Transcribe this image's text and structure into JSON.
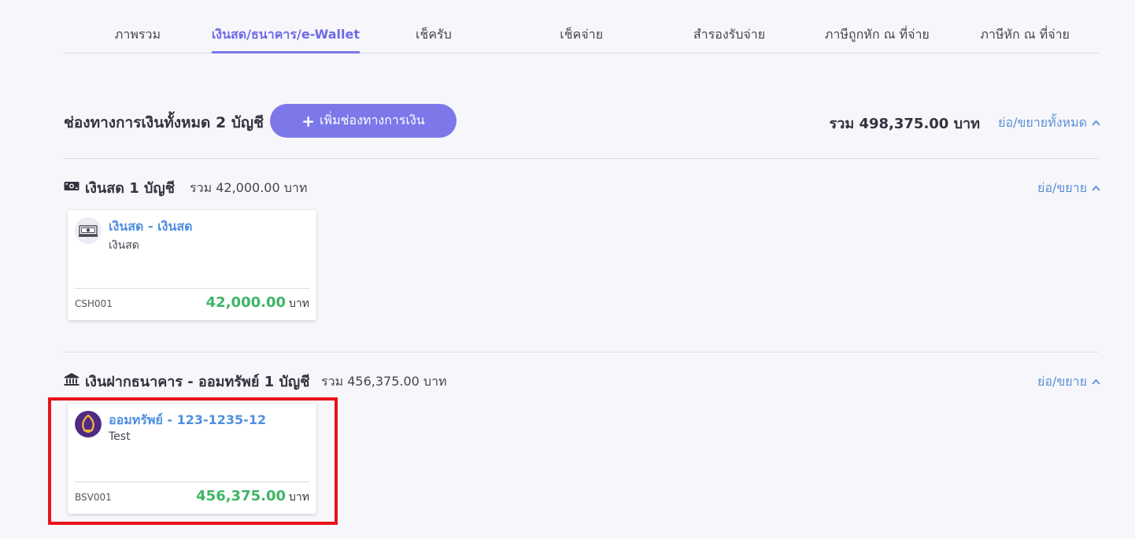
{
  "tabs": [
    {
      "label": "ภาพรวม",
      "active": false
    },
    {
      "label": "เงินสด/ธนาคาร/e-Wallet",
      "active": true
    },
    {
      "label": "เช็ครับ",
      "active": false
    },
    {
      "label": "เช็คจ่าย",
      "active": false
    },
    {
      "label": "สำรองรับจ่าย",
      "active": false
    },
    {
      "label": "ภาษีถูกหัก ณ ที่จ่าย",
      "active": false
    },
    {
      "label": "ภาษีหัก ณ ที่จ่าย",
      "active": false
    }
  ],
  "header": {
    "title": "ช่องทางการเงินทั้งหมด 2 บัญชี",
    "add_button_label": "เพิ่มช่องทางการเงิน",
    "total": "รวม 498,375.00 บาท",
    "collapse_all_label": "ย่อ/ขยายทั้งหมด"
  },
  "sections": [
    {
      "icon": "cash-icon",
      "title": "เงินสด 1 บัญชี",
      "total": "รวม 42,000.00 บาท",
      "collapse_label": "ย่อ/ขยาย",
      "cards": [
        {
          "logo": "cash-logo-icon",
          "name": "เงินสด - เงินสด",
          "description": "เงินสด",
          "code": "CSH001",
          "amount": "42,000.00",
          "currency": "บาท"
        }
      ]
    },
    {
      "icon": "bank-icon",
      "title": "เงินฝากธนาคาร - ออมทรัพย์ 1 บัญชี",
      "total": "รวม 456,375.00 บาท",
      "collapse_label": "ย่อ/ขยาย",
      "cards": [
        {
          "logo": "bank-logo-icon",
          "name": "ออมทรัพย์ - 123-1235-12",
          "description": "Test",
          "code": "BSV001",
          "amount": "456,375.00",
          "currency": "บาท"
        }
      ]
    }
  ],
  "colors": {
    "accent": "#7c78ea",
    "link": "#5a8fd8",
    "amount": "#3fb565",
    "highlight": "#e8131b"
  }
}
